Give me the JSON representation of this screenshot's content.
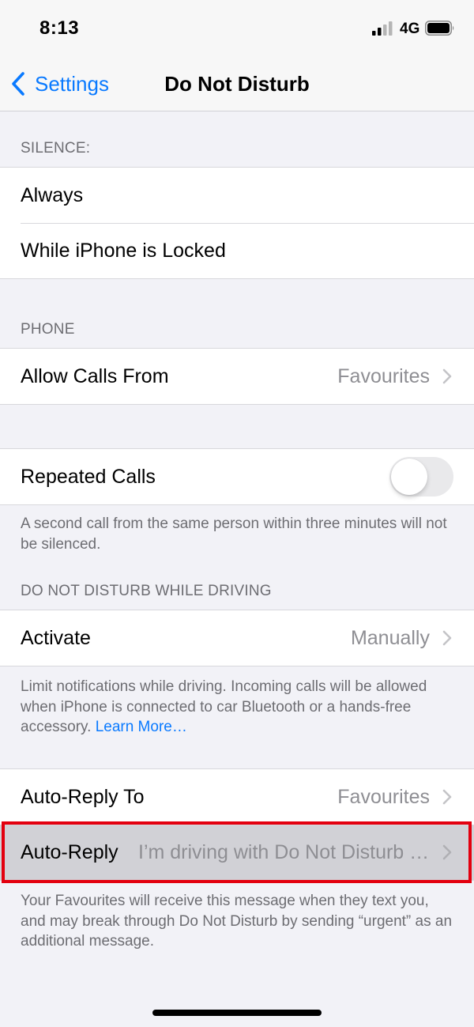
{
  "status_bar": {
    "time": "8:13",
    "network": "4G"
  },
  "nav": {
    "back_label": "Settings",
    "title": "Do Not Disturb"
  },
  "silence": {
    "header": "SILENCE:",
    "items": [
      {
        "label": "Always"
      },
      {
        "label": "While iPhone is Locked"
      }
    ]
  },
  "phone": {
    "header": "PHONE",
    "allow_calls": {
      "label": "Allow Calls From",
      "value": "Favourites"
    },
    "repeated_calls": {
      "label": "Repeated Calls",
      "enabled": false
    },
    "repeated_note": "A second call from the same person within three minutes will not be silenced."
  },
  "driving": {
    "header": "DO NOT DISTURB WHILE DRIVING",
    "activate": {
      "label": "Activate",
      "value": "Manually"
    },
    "note": "Limit notifications while driving. Incoming calls will be allowed when iPhone is connected to car Bluetooth or a hands-free accessory.",
    "learn_more": "Learn More…"
  },
  "auto_reply": {
    "to": {
      "label": "Auto-Reply To",
      "value": "Favourites"
    },
    "reply": {
      "label": "Auto-Reply",
      "value": "I’m driving with Do Not Disturb While Driving turned on. I’ll see your message when I get where I’m going."
    },
    "note": "Your Favourites will receive this message when they text you, and may break through Do Not Disturb by sending “urgent” as an additional message."
  },
  "colors": {
    "accent": "#0a7aff",
    "highlight_border": "#e3000f"
  }
}
